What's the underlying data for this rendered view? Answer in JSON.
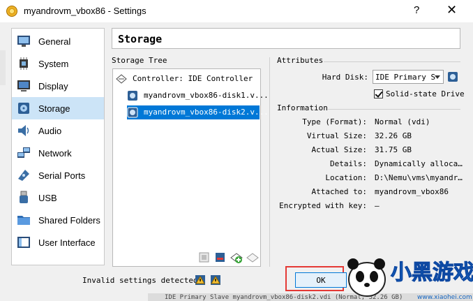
{
  "window": {
    "title": "myandrovm_vbox86 - Settings",
    "help_label": "?",
    "close_label": "✕"
  },
  "sidebar": {
    "items": [
      {
        "label": "General",
        "icon": "monitor-icon"
      },
      {
        "label": "System",
        "icon": "chip-icon"
      },
      {
        "label": "Display",
        "icon": "display-icon"
      },
      {
        "label": "Storage",
        "icon": "disk-icon",
        "selected": true
      },
      {
        "label": "Audio",
        "icon": "speaker-icon"
      },
      {
        "label": "Network",
        "icon": "network-icon"
      },
      {
        "label": "Serial Ports",
        "icon": "serial-icon"
      },
      {
        "label": "USB",
        "icon": "usb-icon"
      },
      {
        "label": "Shared Folders",
        "icon": "folder-icon"
      },
      {
        "label": "User Interface",
        "icon": "ui-icon"
      }
    ]
  },
  "page": {
    "title": "Storage"
  },
  "storage_tree": {
    "label": "Storage Tree",
    "controller": "Controller: IDE Controller",
    "disks": [
      {
        "label": "myandrovm_vbox86-disk1.v..."
      },
      {
        "label": "myandrovm_vbox86-disk2.v...",
        "selected": true
      }
    ]
  },
  "attributes": {
    "label": "Attributes",
    "hard_disk_label": "Hard Disk:",
    "hard_disk_value": "IDE Primary S",
    "ssd_label": "Solid-state Drive",
    "ssd_checked": true
  },
  "information": {
    "label": "Information",
    "rows": [
      {
        "label": "Type (Format):",
        "value": "Normal (vdi)"
      },
      {
        "label": "Virtual Size:",
        "value": "32.26 GB"
      },
      {
        "label": "Actual Size:",
        "value": "31.75 GB"
      },
      {
        "label": "Details:",
        "value": "Dynamically alloca…"
      },
      {
        "label": "Location:",
        "value": "D:\\Nemu\\vms\\myandr…"
      },
      {
        "label": "Attached to:",
        "value": "myandrovm_vbox86"
      },
      {
        "label": "Encrypted with key:",
        "value": "—"
      }
    ]
  },
  "footer": {
    "status": "Invalid settings detected",
    "ok_label": "OK",
    "behind_text": "IDE Primary Slave       myandrovm_vbox86-disk2.vdi (Normal, 32.26 GB)"
  },
  "watermark": {
    "brand": "小黑游戏",
    "url": "www.xiaohei.com"
  },
  "colors": {
    "selection": "#0078d7",
    "sidebar_selected": "#cce4f7",
    "highlight_box": "#e53935"
  }
}
